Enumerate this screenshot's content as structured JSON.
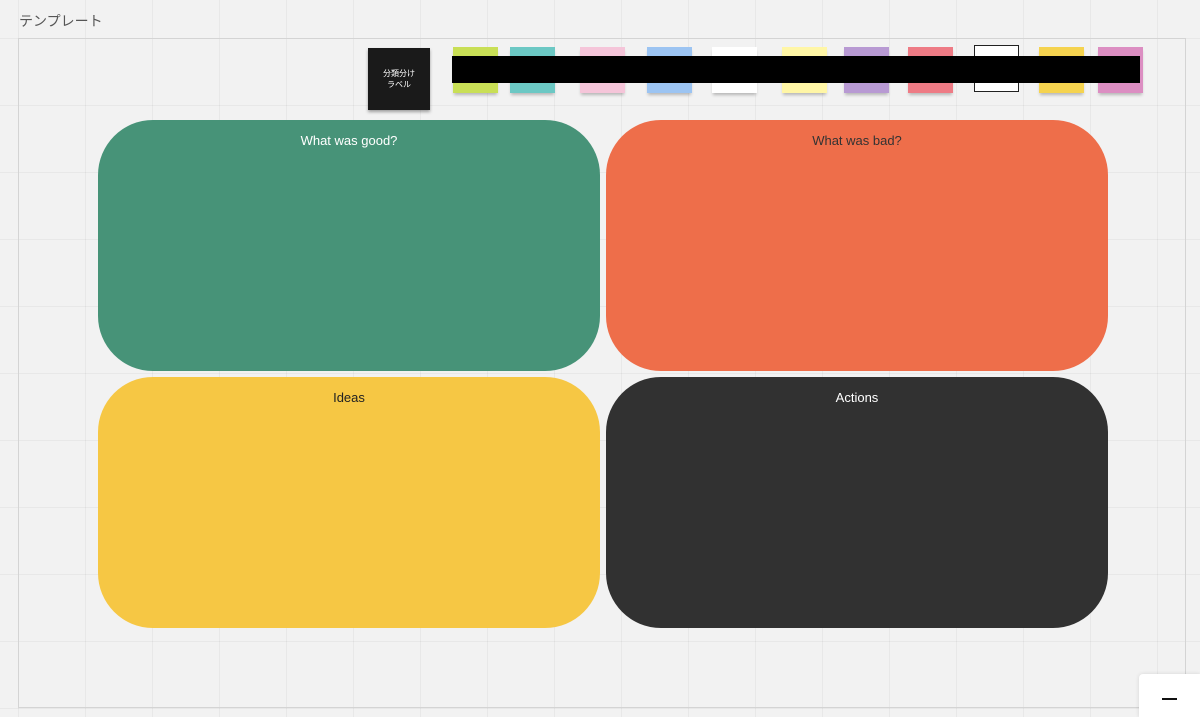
{
  "frame": {
    "title": "テンプレート"
  },
  "label_note": {
    "line1": "分類分け",
    "line2": "ラベル"
  },
  "palette": [
    {
      "name": "lime",
      "color": "#c9df56"
    },
    {
      "name": "teal",
      "color": "#6cc8c4"
    },
    {
      "name": "pink",
      "color": "#f5c5d9"
    },
    {
      "name": "blue",
      "color": "#9cc4f2"
    },
    {
      "name": "white",
      "color": "#ffffff"
    },
    {
      "name": "light-yellow",
      "color": "#fff6a6"
    },
    {
      "name": "purple",
      "color": "#b89ad3"
    },
    {
      "name": "red",
      "color": "#ee7b85"
    },
    {
      "name": "outlined-white",
      "color": "#ffffff"
    },
    {
      "name": "yellow",
      "color": "#f5d34f"
    },
    {
      "name": "magenta",
      "color": "#dc8ec2"
    }
  ],
  "quadrants": {
    "good": {
      "title": "What was good?",
      "color": "#479378",
      "text_color": "#ffffff"
    },
    "bad": {
      "title": "What was bad?",
      "color": "#ee6e4a",
      "text_color": "#333333"
    },
    "ideas": {
      "title": "Ideas",
      "color": "#f6c744",
      "text_color": "#222222"
    },
    "actions": {
      "title": "Actions",
      "color": "#313131",
      "text_color": "#ffffff"
    }
  },
  "zoom": {
    "icon": "minus-icon"
  }
}
